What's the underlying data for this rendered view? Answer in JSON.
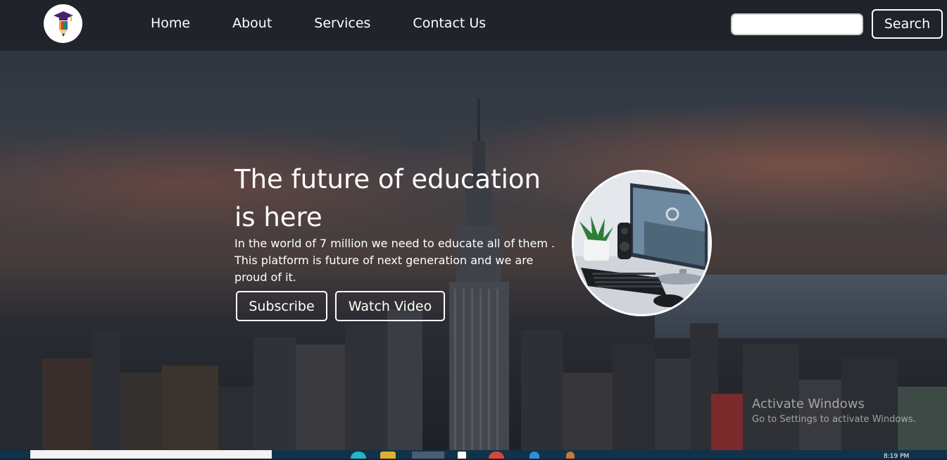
{
  "nav": {
    "links": [
      "Home",
      "About",
      "Services",
      "Contact Us"
    ],
    "search_placeholder": "",
    "search_button": "Search"
  },
  "hero": {
    "title": "The future of education is here",
    "text": "In the world of 7 million we need to educate all of them . This platform is future of next generation and we are proud of it.",
    "subscribe_label": "Subscribe",
    "watch_label": "Watch Video"
  },
  "watermark": {
    "title": "Activate Windows",
    "subtitle": "Go to Settings to activate Windows."
  },
  "taskbar": {
    "time": "8:19 PM"
  },
  "icons": {
    "logo": "graduation-cap-pencil-icon"
  },
  "colors": {
    "navbar": "#1e2127",
    "accent": "#ffffff",
    "taskbar": "#10324a"
  }
}
